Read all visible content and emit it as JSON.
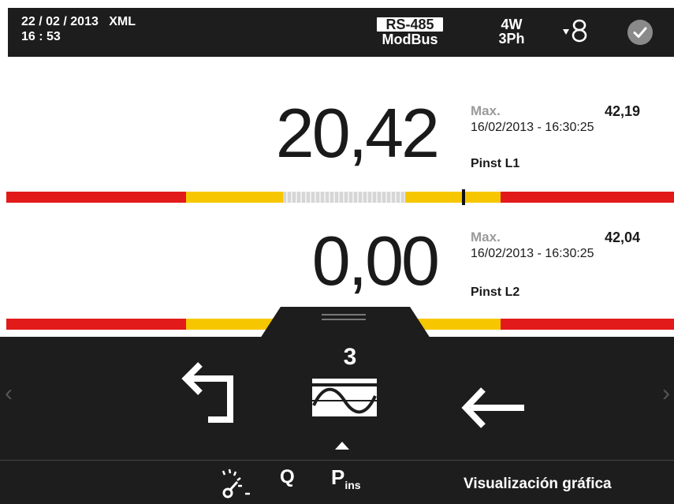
{
  "status_bar": {
    "date": "22 / 02 / 2013",
    "format": "XML",
    "time": "16 : 53",
    "comm_protocol": "RS-485",
    "comm_bus": "ModBus",
    "wiring_wires": "4W",
    "wiring_phases": "3Ph",
    "ct_icon": "current-transformer-icon",
    "ok_icon": "check-circle-icon"
  },
  "measurements": [
    {
      "value": "20,42",
      "max_label": "Max.",
      "max_value": "42,19",
      "max_timestamp": "16/02/2013 - 16:30:25",
      "parameter": "Pinst L1"
    },
    {
      "value": "0,00",
      "max_label": "Max.",
      "max_value": "42,04",
      "max_timestamp": "16/02/2013 - 16:30:25",
      "parameter": "Pinst L2"
    }
  ],
  "colors": {
    "alarm_red": "#e21a1a",
    "warning_yellow": "#f6c700",
    "panel_dark": "#1d1d1d"
  },
  "menu": {
    "back_icon": "back-return-icon",
    "mode_number": "3",
    "mode_icon": "waveform-icon",
    "enter_icon": "arrow-left-icon",
    "bottom_icons": [
      "flicker-gauge-icon"
    ],
    "q_label": "Q",
    "pins_main": "P",
    "pins_sub": "ins",
    "current_view": "Visualización gráfica"
  }
}
